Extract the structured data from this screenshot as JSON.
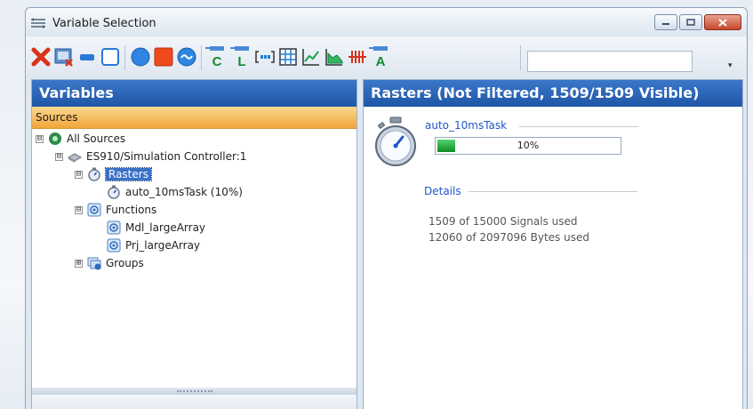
{
  "window": {
    "title": "Variable Selection",
    "title_icon": "list-arrows-icon",
    "controls": [
      "minimize",
      "maximize",
      "close"
    ]
  },
  "toolbar": {
    "buttons": [
      {
        "name": "delete-button",
        "icon": "red-x-icon"
      },
      {
        "name": "remove-selection-button",
        "icon": "window-remove-icon"
      },
      {
        "name": "collapse-button",
        "icon": "blue-minus-icon"
      },
      {
        "name": "select-frame-button",
        "icon": "dashed-frame-icon"
      },
      {
        "name": "blue-circle-button",
        "icon": "blue-circle-icon"
      },
      {
        "name": "red-square-button",
        "icon": "red-square-icon"
      },
      {
        "name": "signal-button",
        "icon": "wave-circle-icon"
      },
      {
        "name": "add-c-button",
        "icon": "plug-c-icon",
        "letter": "C"
      },
      {
        "name": "add-l-button",
        "icon": "plug-l-icon",
        "letter": "L"
      },
      {
        "name": "array-button",
        "icon": "bracket-array-icon"
      },
      {
        "name": "matrix-button",
        "icon": "grid-matrix-icon"
      },
      {
        "name": "curve-button",
        "icon": "line-chart-icon"
      },
      {
        "name": "map-button",
        "icon": "area-chart-icon"
      },
      {
        "name": "axis-button",
        "icon": "axis-points-icon"
      },
      {
        "name": "add-a-button",
        "icon": "plug-a-icon",
        "letter": "A"
      }
    ],
    "search_value": ""
  },
  "left_panel": {
    "header": "Variables",
    "section": "Sources",
    "tree": [
      {
        "label": "All Sources",
        "level": 0,
        "icon": "sources-icon",
        "expander": "⊟"
      },
      {
        "label": "ES910/Simulation Controller:1",
        "level": 1,
        "icon": "device-icon",
        "expander": "⊟"
      },
      {
        "label": "Rasters",
        "level": 2,
        "icon": "stopwatch-icon",
        "expander": "⊟",
        "selected": true
      },
      {
        "label": "auto_10msTask (10%)",
        "level": 3,
        "icon": "stopwatch-icon",
        "expander": ""
      },
      {
        "label": "Functions",
        "level": 2,
        "icon": "function-icon",
        "expander": "⊟"
      },
      {
        "label": "Mdl_largeArray",
        "level": 3,
        "icon": "function-icon",
        "expander": ""
      },
      {
        "label": "Prj_largeArray",
        "level": 3,
        "icon": "function-icon",
        "expander": ""
      },
      {
        "label": "Groups",
        "level": 2,
        "icon": "groups-icon",
        "expander": "⊞"
      }
    ]
  },
  "right_panel": {
    "header": "Rasters (Not Filtered, 1509/1509 Visible)",
    "raster_name": "auto_10msTask",
    "progress_label": "10%",
    "progress_fraction": 0.1,
    "details_label": "Details",
    "details_lines": [
      "1509 of 15000 Signals used",
      "12060 of 2097096 Bytes used"
    ]
  },
  "colors": {
    "panel_header": "#2a63b5",
    "sources_bar": "#f5b84f",
    "selection": "#3a71c6",
    "link_blue": "#1f56c8",
    "progress_green": "#1fa83a"
  }
}
